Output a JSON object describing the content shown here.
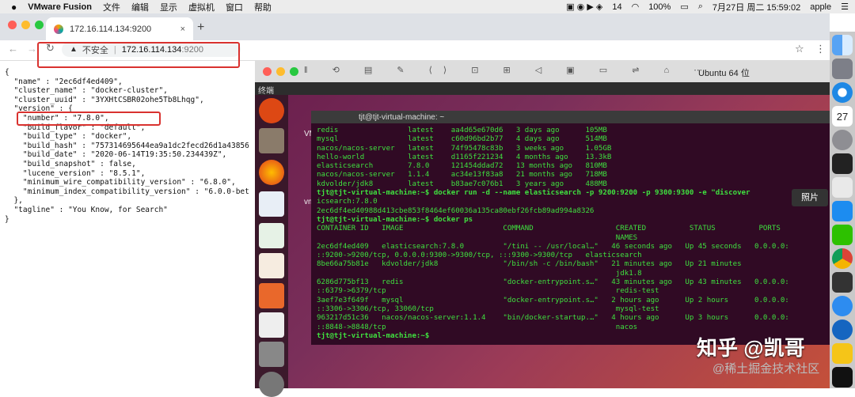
{
  "menubar": {
    "apple": "",
    "app": "VMware Fusion",
    "items": [
      "文件",
      "编辑",
      "显示",
      "虚拟机",
      "窗口",
      "帮助"
    ],
    "status": {
      "badge": "14",
      "battery": "100%",
      "datetime": "7月27日 周二  15:59:02",
      "user": "apple"
    }
  },
  "browser": {
    "tab_title": "172.16.114.134:9200",
    "tab_close": "×",
    "new_tab": "+",
    "insecure": "不安全",
    "url_host": "172.16.114.134",
    "url_port": ":9200",
    "star": "☆"
  },
  "json_lines": [
    "{",
    "  \"name\" : \"2ec6df4ed409\",",
    "  \"cluster_name\" : \"docker-cluster\",",
    "  \"cluster_uuid\" : \"3YXHtCSBR02ohe5Tb8Lhqg\",",
    "  \"version\" : {",
    "    \"number\" : \"7.8.0\",",
    "    \"build_flavor\" : \"default\",",
    "    \"build_type\" : \"docker\",",
    "    \"build_hash\" : \"757314695644ea9a1dc2fecd26d1a43856",
    "    \"build_date\" : \"2020-06-14T19:35:50.234439Z\",",
    "    \"build_snapshot\" : false,",
    "    \"lucene_version\" : \"8.5.1\",",
    "    \"minimum_wire_compatibility_version\" : \"6.8.0\",",
    "    \"minimum_index_compatibility_version\" : \"6.0.0-bet",
    "  },",
    "  \"tagline\" : \"You Know, for Search\"",
    "}"
  ],
  "vm": {
    "title": "Ubuntu 64 位",
    "top_label": "终端",
    "desk_labels": [
      "VM",
      "vm"
    ],
    "photo_label": "照片"
  },
  "terminal": {
    "title": "tjt@tjt-virtual-machine: ~",
    "lines": [
      "redis                latest    aa4d65e670d6   3 days ago      105MB",
      "mysql                latest    c60d96bd2b77   4 days ago      514MB",
      "nacos/nacos-server   latest    74f95478c83b   3 weeks ago     1.05GB",
      "hello-world          latest    d1165f221234   4 months ago    13.3kB",
      "elasticsearch        7.8.0     121454ddad72   13 months ago   810MB",
      "nacos/nacos-server   1.1.4     ac34e13f83a8   21 months ago   718MB",
      "kdvolder/jdk8        latest    b83ae7c076b1   3 years ago     488MB",
      "tjt@tjt-virtual-machine:~$ docker run -d --name elasticsearch -p 9200:9200 -p 9300:9300 -e \"discover",
      "icsearch:7.8.0",
      "2ec6df4ed40988d413cbe853f8464ef60036a135ca80ebf26fcb89ad994a8326",
      "tjt@tjt-virtual-machine:~$ docker ps",
      "CONTAINER ID   IMAGE                       COMMAND                   CREATED          STATUS          PORTS",
      "                                                                     NAMES",
      "2ec6df4ed409   elasticsearch:7.8.0         \"/tini -- /usr/local…\"   46 seconds ago   Up 45 seconds   0.0.0.0:",
      "::9200->9200/tcp, 0.0.0.0:9300->9300/tcp, :::9300->9300/tcp   elasticsearch",
      "8be66a75b81e   kdvolder/jdk8               \"/bin/sh -c /bin/bash\"   21 minutes ago   Up 21 minutes",
      "                                                                     jdk1.8",
      "6286d775bf13   redis                       \"docker-entrypoint.s…\"   43 minutes ago   Up 43 minutes   0.0.0.0:",
      "::6379->6379/tcp                                                     redis-test",
      "3aef7e3f649f   mysql                       \"docker-entrypoint.s…\"   2 hours ago      Up 2 hours      0.0.0.0:",
      "::3306->3306/tcp, 33060/tcp                                          mysql-test",
      "963217d51c36   nacos/nacos-server:1.1.4    \"bin/docker-startup.…\"   4 hours ago      Up 3 hours      0.0.0.0:",
      "::8848->8848/tcp                                                     nacos",
      "tjt@tjt-virtual-machine:~$ "
    ]
  },
  "watermark": {
    "main": "知乎 @凯哥",
    "sub": "@稀土掘金技术社区"
  },
  "dock_badge": "27"
}
